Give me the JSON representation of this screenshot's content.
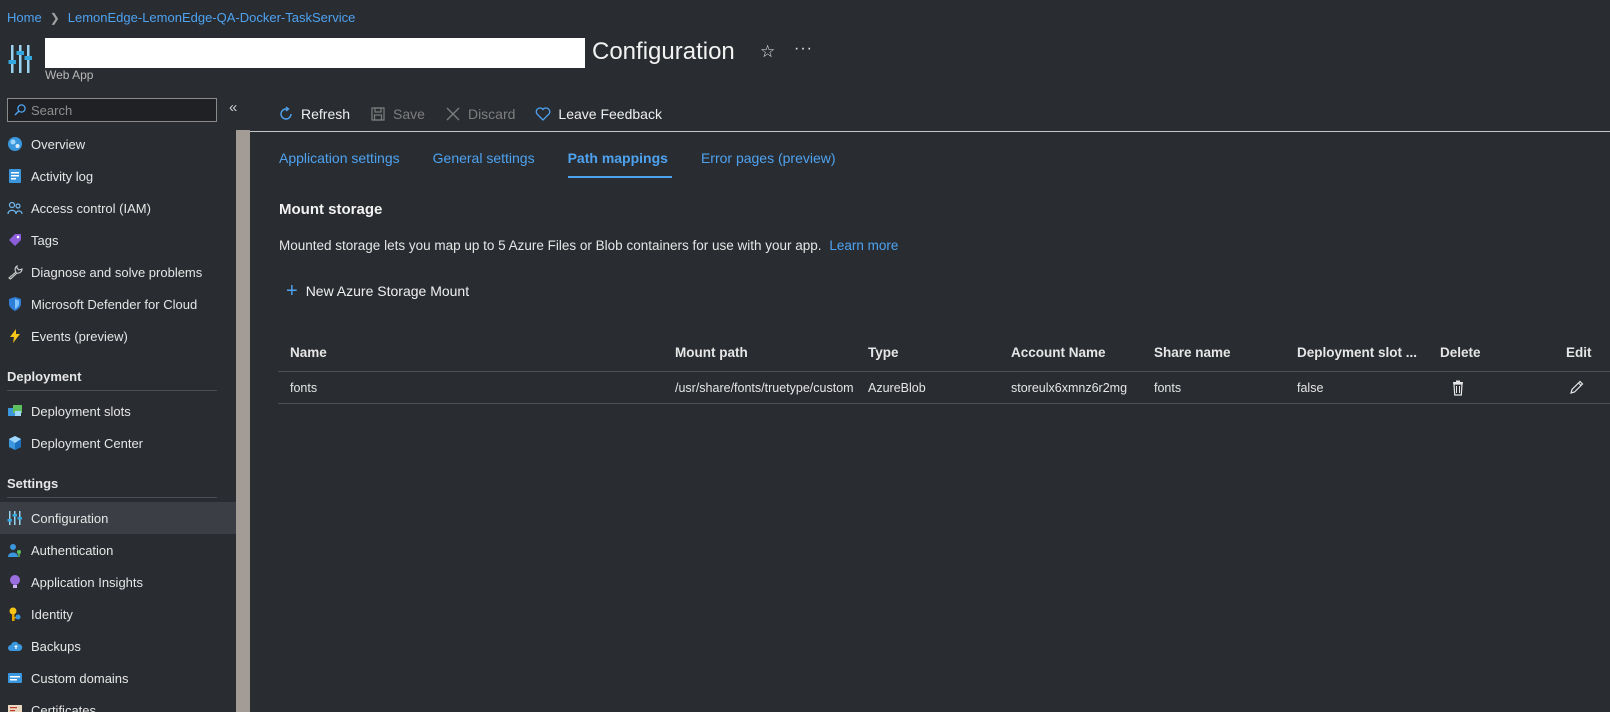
{
  "breadcrumb": [
    "Home",
    "LemonEdge-LemonEdge-QA-Docker-TaskService"
  ],
  "header": {
    "title": "Configuration",
    "subtitle": "Web App"
  },
  "sidebar": {
    "search_placeholder": "Search",
    "items_top": [
      {
        "label": "Overview",
        "icon": "globe-icon"
      },
      {
        "label": "Activity log",
        "icon": "log-icon"
      },
      {
        "label": "Access control (IAM)",
        "icon": "people-icon"
      },
      {
        "label": "Tags",
        "icon": "tag-icon"
      },
      {
        "label": "Diagnose and solve problems",
        "icon": "wrench-icon"
      },
      {
        "label": "Microsoft Defender for Cloud",
        "icon": "shield-icon"
      },
      {
        "label": "Events (preview)",
        "icon": "lightning-icon"
      }
    ],
    "deployment": {
      "title": "Deployment",
      "items": [
        {
          "label": "Deployment slots",
          "icon": "slots-icon"
        },
        {
          "label": "Deployment Center",
          "icon": "cube-icon"
        }
      ]
    },
    "settings": {
      "title": "Settings",
      "items": [
        {
          "label": "Configuration",
          "icon": "sliders-icon",
          "active": true
        },
        {
          "label": "Authentication",
          "icon": "person-key-icon"
        },
        {
          "label": "Application Insights",
          "icon": "bulb-icon"
        },
        {
          "label": "Identity",
          "icon": "key-icon"
        },
        {
          "label": "Backups",
          "icon": "cloud-icon"
        },
        {
          "label": "Custom domains",
          "icon": "domain-icon"
        },
        {
          "label": "Certificates",
          "icon": "certificate-icon"
        }
      ]
    }
  },
  "toolbar": {
    "refresh": "Refresh",
    "save": "Save",
    "discard": "Discard",
    "feedback": "Leave Feedback"
  },
  "tabs": [
    {
      "label": "Application settings",
      "active": false
    },
    {
      "label": "General settings",
      "active": false
    },
    {
      "label": "Path mappings",
      "active": true
    },
    {
      "label": "Error pages (preview)",
      "active": false
    }
  ],
  "main": {
    "section_title": "Mount storage",
    "description": "Mounted storage lets you map up to 5 Azure Files or Blob containers for use with your app.",
    "learn_more": "Learn more",
    "new_mount": "New Azure Storage Mount"
  },
  "table": {
    "columns": [
      "Name",
      "Mount path",
      "Type",
      "Account Name",
      "Share name",
      "Deployment slot ...",
      "Delete",
      "Edit"
    ],
    "rows": [
      [
        "fonts",
        "/usr/share/fonts/truetype/custom",
        "AzureBlob",
        "storeulx6xmnz6r2mg",
        "fonts",
        "false"
      ]
    ]
  },
  "colors": {
    "background": "#292c31",
    "accent": "#4ea3f1",
    "text": "#e6e6e6"
  }
}
